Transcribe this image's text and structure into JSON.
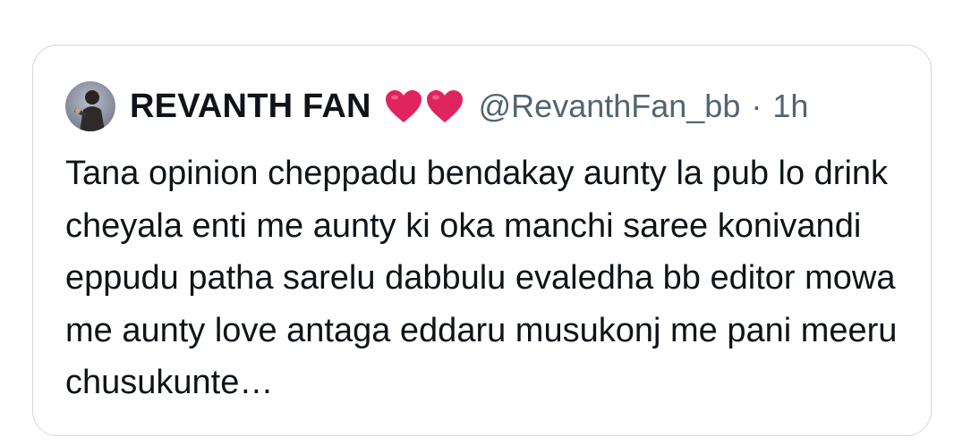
{
  "tweet": {
    "display_name": "REVANTH FAN",
    "handle": "@RevanthFan_bb",
    "separator": "·",
    "time": "1h",
    "emoji": [
      "heart-icon",
      "heart-icon"
    ],
    "heart_color": "#e0245e",
    "text": "Tana opinion cheppadu bendakay aunty la pub lo drink cheyala enti me aunty ki oka manchi saree konivandi eppudu patha sarelu dabbulu evaledha bb editor mowa me aunty love antaga eddaru musukonj me pani meeru chusukunte…"
  },
  "colors": {
    "border": "#cfd9de",
    "text": "#0f1419",
    "secondary": "#536471"
  }
}
